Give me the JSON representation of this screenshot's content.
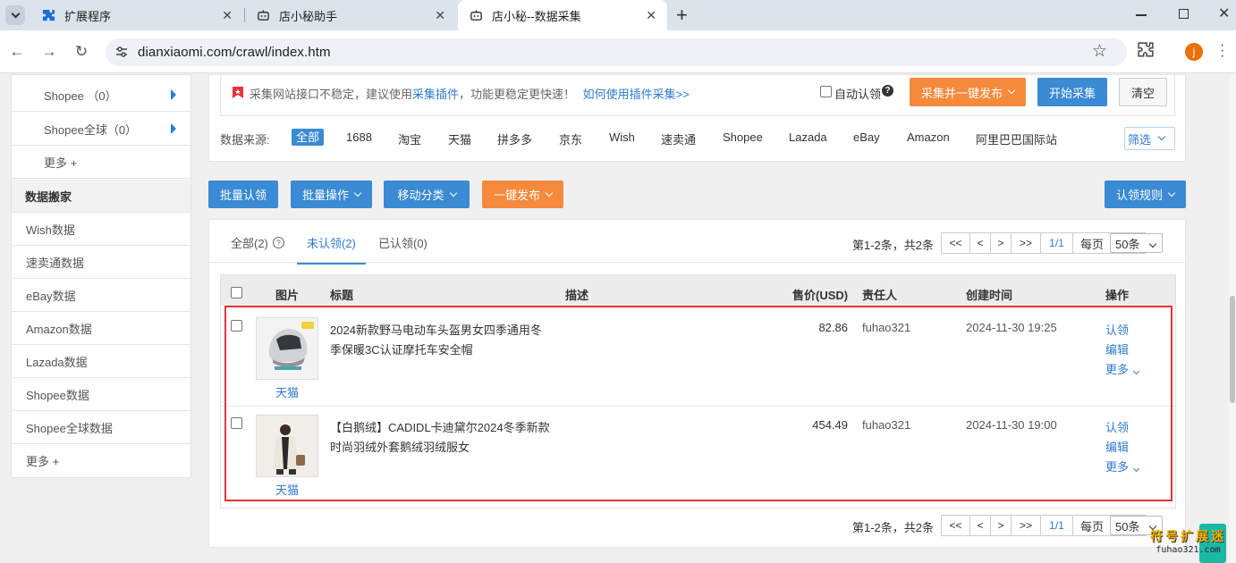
{
  "browser": {
    "tabs": [
      {
        "label": "扩展程序",
        "icon": "puzzle-icon"
      },
      {
        "label": "店小秘助手",
        "icon": "bot-icon"
      },
      {
        "label": "店小秘--数据采集",
        "icon": "bot-icon"
      }
    ],
    "url": "dianxiaomi.com/crawl/index.htm",
    "profile_initial": "j"
  },
  "sidebar": {
    "top_items": [
      {
        "label": "Shopee （0）"
      },
      {
        "label": "Shopee全球（0）"
      },
      {
        "label": "更多 +"
      }
    ],
    "section_title": "数据搬家",
    "items": [
      {
        "label": "Wish数据"
      },
      {
        "label": "速卖通数据"
      },
      {
        "label": "eBay数据"
      },
      {
        "label": "Amazon数据"
      },
      {
        "label": "Lazada数据"
      },
      {
        "label": "Shopee数据"
      },
      {
        "label": "Shopee全球数据"
      },
      {
        "label": "更多 +"
      }
    ]
  },
  "crawl": {
    "notice_prefix": "采集网站接口不稳定，建议使用",
    "notice_link1": "采集插件",
    "notice_mid": "，功能更稳定更快速！",
    "notice_link2": "如何使用插件采集>>",
    "auto_claim_label": "自动认领",
    "btn_collect_publish": "采集并一键发布",
    "btn_start": "开始采集",
    "btn_clear": "清空",
    "source_label": "数据来源:",
    "sources": [
      "全部",
      "1688",
      "淘宝",
      "天猫",
      "拼多多",
      "京东",
      "Wish",
      "速卖通",
      "Shopee",
      "Lazada",
      "eBay",
      "Amazon",
      "阿里巴巴国际站"
    ],
    "filter_label": "筛选"
  },
  "actions": {
    "batch_claim": "批量认领",
    "batch_ops": "批量操作",
    "move_category": "移动分类",
    "one_click_publish": "一键发布",
    "claim_rules": "认领规则"
  },
  "list": {
    "tabs": [
      {
        "label": "全部(2)"
      },
      {
        "label": "未认领(2)"
      },
      {
        "label": "已认领(0)"
      }
    ],
    "pagination": {
      "summary": "第1-2条，共2条",
      "first": "<<",
      "prev": "<",
      "next": ">",
      "last": ">>",
      "page": "1/1",
      "per_page_label": "每页",
      "per_page_value": "50条"
    },
    "columns": {
      "image": "图片",
      "title": "标题",
      "desc": "描述",
      "price": "售价(USD)",
      "owner": "责任人",
      "created": "创建时间",
      "ops": "操作"
    },
    "rows": [
      {
        "title_line1": "2024新款野马电动车头盔男女四季通用冬",
        "title_line2": "季保暖3C认证摩托车安全帽",
        "source": "天猫",
        "price": "82.86",
        "owner": "fuhao321",
        "created": "2024-11-30 19:25",
        "op_claim": "认领",
        "op_edit": "编辑",
        "op_more": "更多"
      },
      {
        "title_line1": "【白鹅绒】CADIDL卡迪黛尔2024冬季新款",
        "title_line2": "时尚羽绒外套鹅绒羽绒服女",
        "source": "天猫",
        "price": "454.49",
        "owner": "fuhao321",
        "created": "2024-11-30 19:00",
        "op_claim": "认领",
        "op_edit": "编辑",
        "op_more": "更多"
      }
    ]
  },
  "watermark": {
    "line1": "符号扩展迷",
    "line2": "fuhao321.com"
  },
  "colors": {
    "accent_blue": "#3a8ad4",
    "accent_orange": "#f58a3c",
    "highlight_red": "#e8323c"
  }
}
